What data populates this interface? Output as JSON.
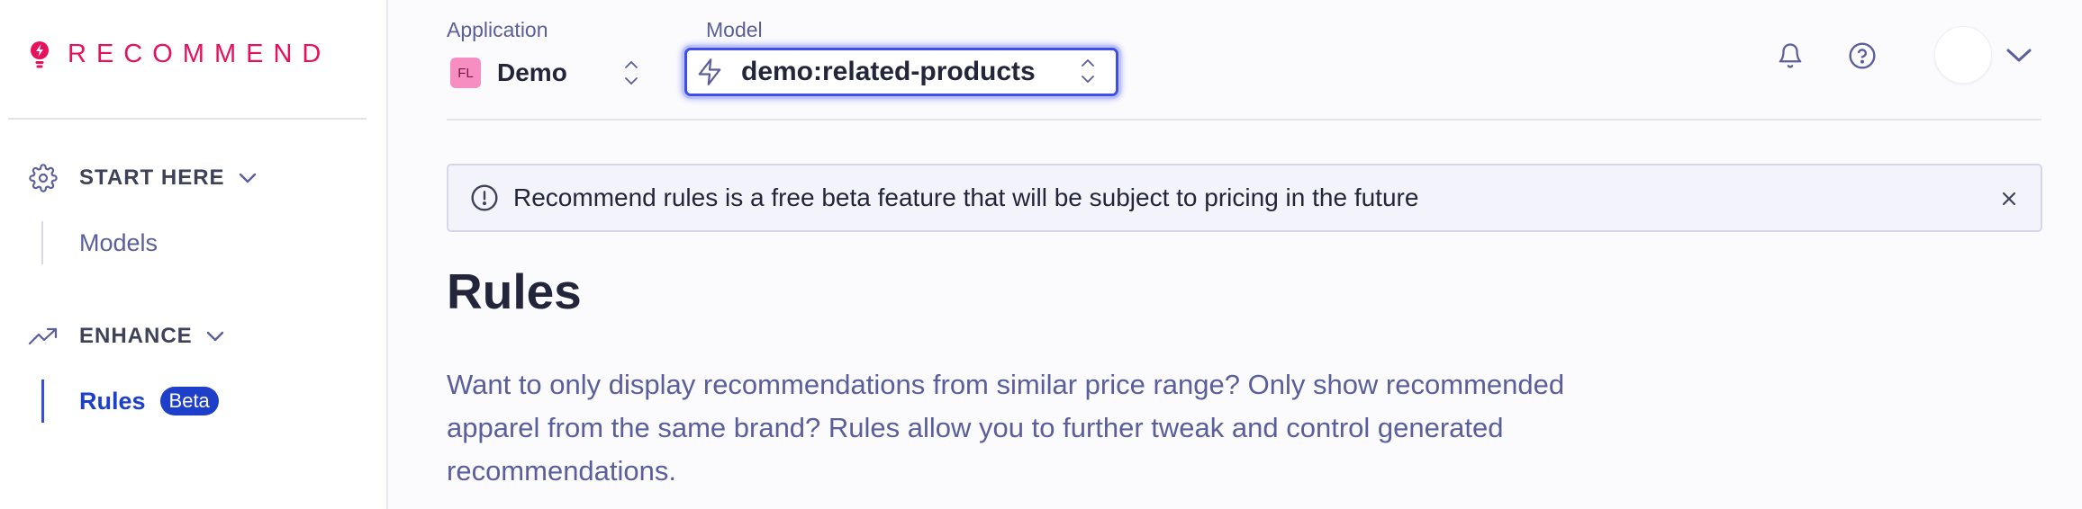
{
  "brand": {
    "logo_text": "RECOMMEND",
    "accent": "#e8105d"
  },
  "sidebar": {
    "sections": [
      {
        "title": "START HERE",
        "icon": "gear-icon",
        "items": [
          {
            "label": "Models",
            "active": false
          }
        ]
      },
      {
        "title": "ENHANCE",
        "icon": "trending-up-icon",
        "items": [
          {
            "label": "Rules",
            "badge": "Beta",
            "active": true
          }
        ]
      }
    ]
  },
  "header": {
    "application": {
      "label": "Application",
      "avatar": "FL",
      "value": "Demo"
    },
    "model": {
      "label": "Model",
      "value": "demo:related-products"
    },
    "icons": [
      "bell-icon",
      "help-icon",
      "user-avatar",
      "chevron-down-icon"
    ]
  },
  "banner": {
    "text": "Recommend rules is a free beta feature that will be subject to pricing in the future"
  },
  "page": {
    "title": "Rules",
    "description": "Want to only display recommendations from similar price range? Only show recommended apparel from the same brand? Rules allow you to further tweak and control generated recommendations."
  },
  "colors": {
    "primary": "#1e3fc9",
    "text": "#23263b",
    "muted": "#5a5e9a",
    "focus": "#3f4ee8"
  }
}
